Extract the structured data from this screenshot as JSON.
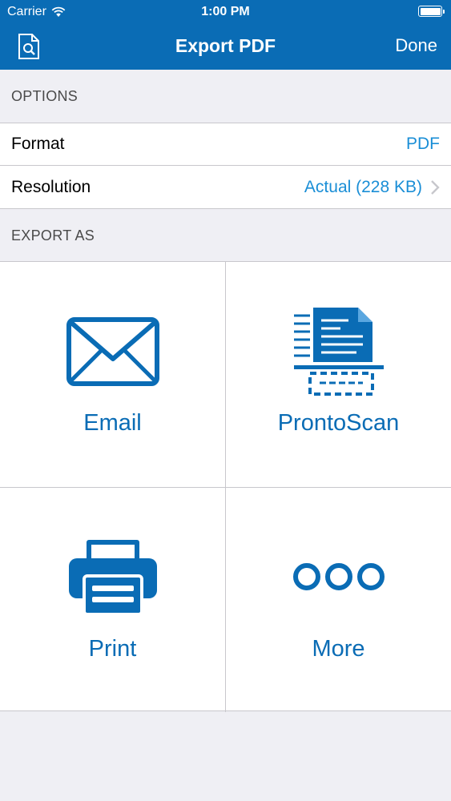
{
  "status_bar": {
    "carrier": "Carrier",
    "time": "1:00 PM"
  },
  "nav": {
    "title": "Export PDF",
    "done_label": "Done"
  },
  "options": {
    "header": "OPTIONS",
    "format": {
      "label": "Format",
      "value": "PDF"
    },
    "resolution": {
      "label": "Resolution",
      "value": "Actual (228 KB)"
    }
  },
  "export_as": {
    "header": "EXPORT AS",
    "tiles": [
      {
        "label": "Email",
        "icon": "envelope-icon"
      },
      {
        "label": "ProntoScan",
        "icon": "scanner-document-icon"
      },
      {
        "label": "Print",
        "icon": "printer-icon"
      },
      {
        "label": "More",
        "icon": "more-dots-icon"
      }
    ]
  },
  "colors": {
    "brand": "#0a6cb5",
    "value_text": "#1a8ed6",
    "background": "#efeff4",
    "separator": "#c8c7cc"
  }
}
